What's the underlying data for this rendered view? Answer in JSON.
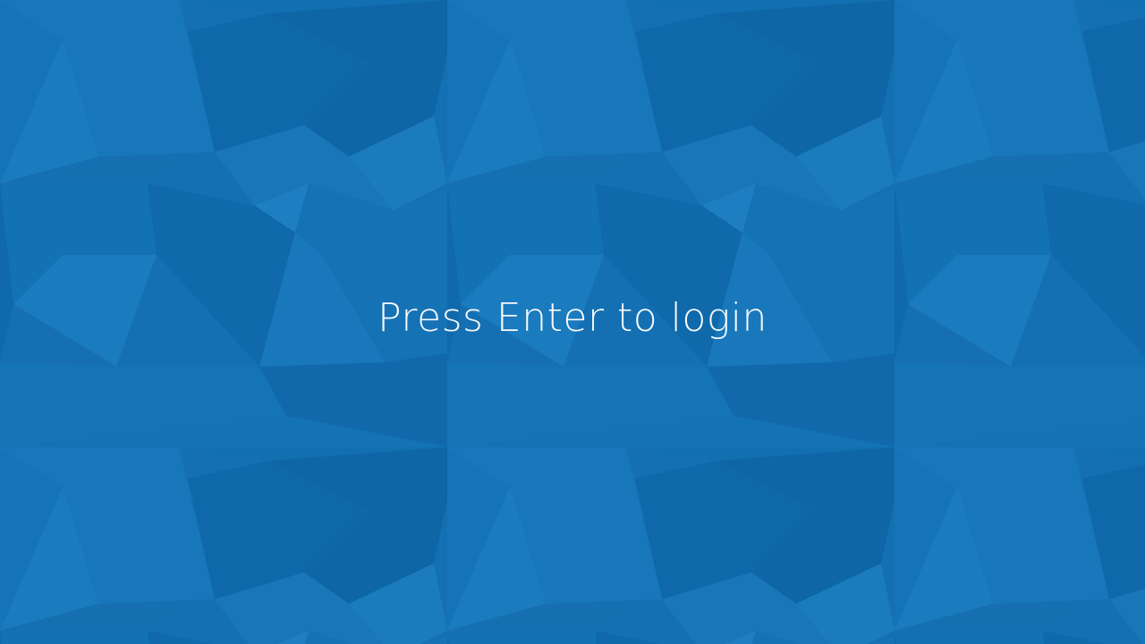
{
  "lock_screen": {
    "prompt": "Press Enter to login"
  },
  "colors": {
    "background": "#1470b3",
    "light_facet": "#1a7abd",
    "dark_facet": "#0f66a8",
    "text": "#ffffff"
  }
}
